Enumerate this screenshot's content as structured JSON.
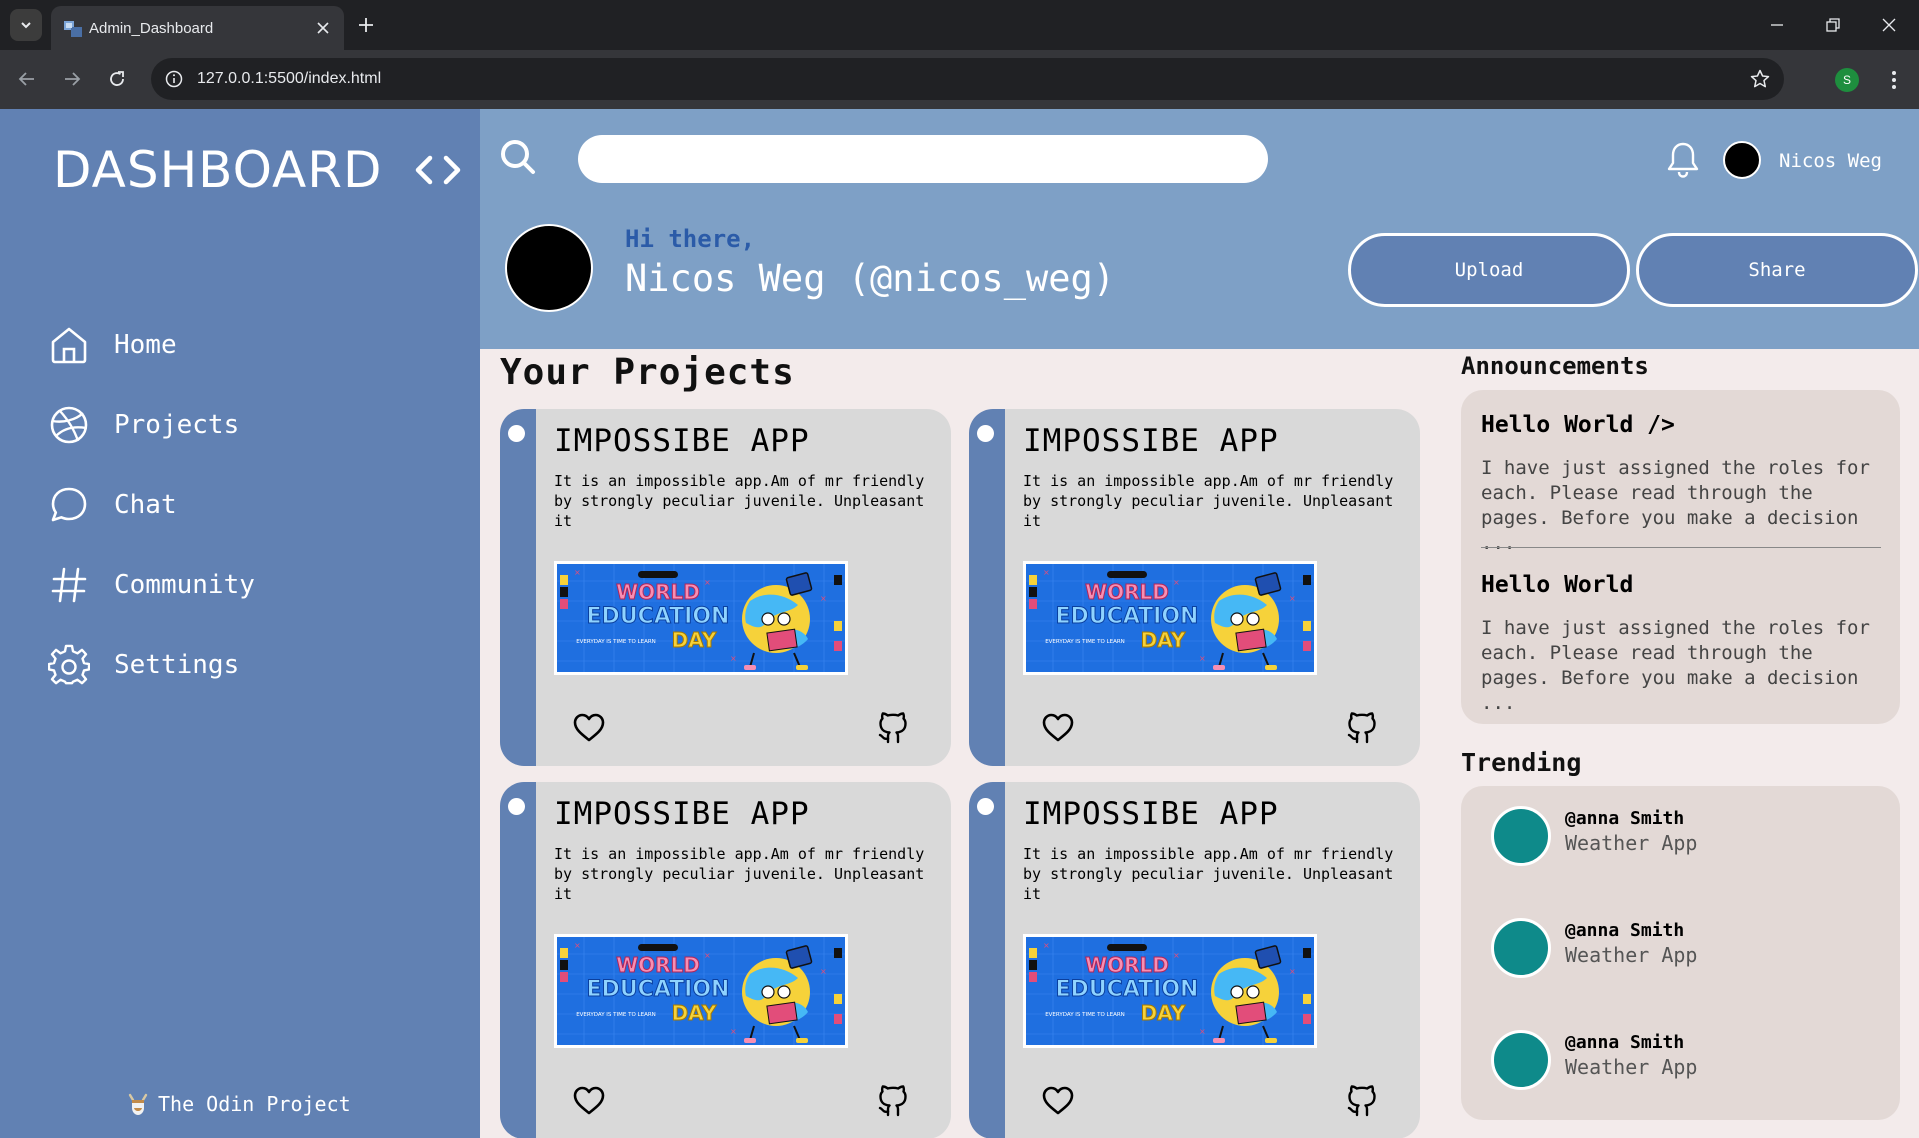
{
  "browser": {
    "tab_title": "Admin_Dashboard",
    "url": "127.0.0.1:5500/index.html",
    "profile_initial": "S"
  },
  "sidebar": {
    "brand": "DASHBOARD",
    "items": [
      {
        "label": "Home",
        "icon": "home-icon"
      },
      {
        "label": "Projects",
        "icon": "dribbble-icon"
      },
      {
        "label": "Chat",
        "icon": "chat-bubble-icon"
      },
      {
        "label": "Community",
        "icon": "hash-icon"
      },
      {
        "label": "Settings",
        "icon": "gear-icon"
      }
    ],
    "footer": "The Odin Project"
  },
  "header": {
    "search_placeholder": "",
    "user_name": "Nicos Weg",
    "greeting": "Hi there,",
    "profile_name": "Nicos Weg (@nicos_weg)",
    "upload_label": "Upload",
    "share_label": "Share"
  },
  "projects": {
    "title": "Your Projects",
    "cards": [
      {
        "title": "IMPOSSIBE APP",
        "description": "It is an impossible app.Am of mr friendly by strongly peculiar juvenile. Unpleasant it"
      },
      {
        "title": "IMPOSSIBE APP",
        "description": "It is an impossible app.Am of mr friendly by strongly peculiar juvenile. Unpleasant it"
      },
      {
        "title": "IMPOSSIBE APP",
        "description": "It is an impossible app.Am of mr friendly by strongly peculiar juvenile. Unpleasant it"
      },
      {
        "title": "IMPOSSIBE APP",
        "description": "It is an impossible app.Am of mr friendly by strongly peculiar juvenile. Unpleasant it"
      }
    ],
    "banner": {
      "line1": "WORLD",
      "line2": "EDUCATION",
      "line3": "DAY",
      "tagline": "EVERYDAY IS TIME TO LEARN"
    }
  },
  "announcements": {
    "title": "Announcements",
    "items": [
      {
        "title": "Hello World />",
        "body": "I have just assigned the roles for each. Please read through the pages. Before you make a decision ..."
      },
      {
        "title": "Hello World",
        "body": "I have just assigned the roles for each. Please read through the pages. Before you make a decision ..."
      }
    ]
  },
  "trending": {
    "title": "Trending",
    "items": [
      {
        "user": "@anna Smith",
        "app": "Weather App"
      },
      {
        "user": "@anna Smith",
        "app": "Weather App"
      },
      {
        "user": "@anna Smith",
        "app": "Weather App"
      }
    ]
  },
  "colors": {
    "sidebar": "#6181b3",
    "header": "#7ea0c6",
    "page": "#f3ebeb",
    "card": "#d9d9d9",
    "accent_teal": "#0e8a8a",
    "greeting": "#2b5ba8"
  }
}
